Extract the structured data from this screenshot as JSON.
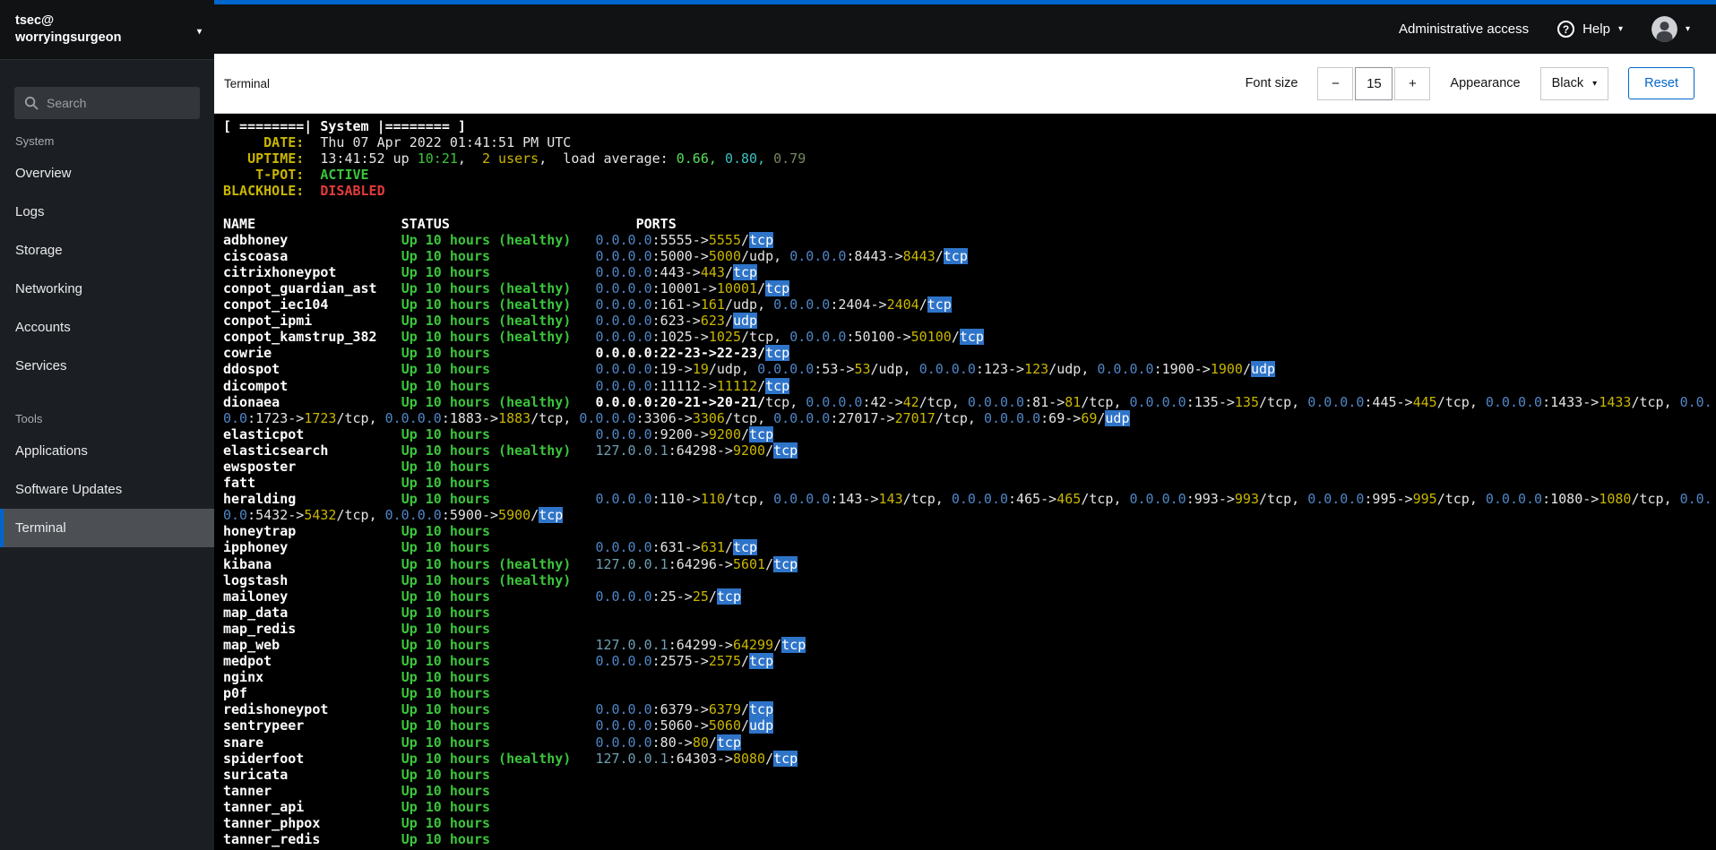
{
  "colors": {
    "accent": "#0066cc",
    "masthead_bg": "#101214",
    "sidebar_bg": "#1b1e22",
    "selected_bg": "#4c5054",
    "terminal_bg": "#000000",
    "term_fg": "#e4e4e4",
    "term_green": "#3bc43b",
    "term_green_bright": "#56e056",
    "term_yellow": "#c9b600",
    "term_red": "#e23b3b",
    "term_ip": "#4f86c6",
    "term_ip_local": "#6f9fb3",
    "term_teal": "#3fc0c0",
    "term_dim": "#75875f",
    "proto_hl": "#2e74c9"
  },
  "host": {
    "line1": "tsec@",
    "line2": "worryingsurgeon"
  },
  "masthead": {
    "admin_access_label": "Administrative access",
    "help_label": "Help"
  },
  "sidebar": {
    "search_placeholder": "Search",
    "active_item": "Terminal",
    "sections": [
      {
        "label": "System",
        "items": [
          "Overview",
          "Logs",
          "Storage",
          "Networking",
          "Accounts",
          "Services"
        ]
      },
      {
        "label": "Tools",
        "items": [
          "Applications",
          "Software Updates",
          "Terminal"
        ]
      }
    ]
  },
  "toolbar": {
    "title": "Terminal",
    "font_size_label": "Font size",
    "decrease_label": "−",
    "font_size_value": "15",
    "increase_label": "+",
    "appearance_label": "Appearance",
    "theme_value": "Black",
    "reset_label": "Reset"
  },
  "terminal": {
    "banner": "[ ========| System |======== ]",
    "info": [
      {
        "label": "DATE:",
        "segments": [
          {
            "text": "Thu 07 Apr 2022 01:41:51 PM UTC",
            "color": "fg"
          }
        ]
      },
      {
        "label": "UPTIME:",
        "segments": [
          {
            "text": "13:41:52 up ",
            "color": "fg"
          },
          {
            "text": "10:21",
            "color": "green"
          },
          {
            "text": ",  ",
            "color": "fg"
          },
          {
            "text": "2 users",
            "color": "yellow"
          },
          {
            "text": ",  load average: ",
            "color": "fg"
          },
          {
            "text": "0.66,",
            "color": "green_bright"
          },
          {
            "text": " ",
            "color": "fg"
          },
          {
            "text": "0.80,",
            "color": "teal"
          },
          {
            "text": " ",
            "color": "fg"
          },
          {
            "text": "0.79",
            "color": "dim"
          }
        ]
      },
      {
        "label": "T-POT:",
        "segments": [
          {
            "text": "ACTIVE",
            "color": "green",
            "bold": true
          }
        ]
      },
      {
        "label": "BLACKHOLE:",
        "segments": [
          {
            "text": "DISABLED",
            "color": "red",
            "bold": true
          }
        ]
      }
    ],
    "columns": [
      "NAME",
      "STATUS",
      "PORTS"
    ],
    "services": [
      {
        "name": "adbhoney",
        "status": "Up 10 hours (healthy)",
        "ports": [
          {
            "ip": "0.0.0.0",
            "from": "5555",
            "to": "5555",
            "proto": "tcp"
          }
        ]
      },
      {
        "name": "ciscoasa",
        "status": "Up 10 hours",
        "ports": [
          {
            "ip": "0.0.0.0",
            "from": "5000",
            "to": "5000",
            "proto": "udp"
          },
          {
            "ip": "0.0.0.0",
            "from": "8443",
            "to": "8443",
            "proto": "tcp"
          }
        ]
      },
      {
        "name": "citrixhoneypot",
        "status": "Up 10 hours",
        "ports": [
          {
            "ip": "0.0.0.0",
            "from": "443",
            "to": "443",
            "proto": "tcp"
          }
        ]
      },
      {
        "name": "conpot_guardian_ast",
        "status": "Up 10 hours (healthy)",
        "ports": [
          {
            "ip": "0.0.0.0",
            "from": "10001",
            "to": "10001",
            "proto": "tcp"
          }
        ]
      },
      {
        "name": "conpot_iec104",
        "status": "Up 10 hours (healthy)",
        "ports": [
          {
            "ip": "0.0.0.0",
            "from": "161",
            "to": "161",
            "proto": "udp"
          },
          {
            "ip": "0.0.0.0",
            "from": "2404",
            "to": "2404",
            "proto": "tcp"
          }
        ]
      },
      {
        "name": "conpot_ipmi",
        "status": "Up 10 hours (healthy)",
        "ports": [
          {
            "ip": "0.0.0.0",
            "from": "623",
            "to": "623",
            "proto": "udp"
          }
        ]
      },
      {
        "name": "conpot_kamstrup_382",
        "status": "Up 10 hours (healthy)",
        "ports": [
          {
            "ip": "0.0.0.0",
            "from": "1025",
            "to": "1025",
            "proto": "tcp"
          },
          {
            "ip": "0.0.0.0",
            "from": "50100",
            "to": "50100",
            "proto": "tcp"
          }
        ]
      },
      {
        "name": "cowrie",
        "status": "Up 10 hours",
        "ports": [
          {
            "ip": "0.0.0.0",
            "from": "22-23",
            "to": "22-23",
            "proto": "tcp",
            "emph": true
          }
        ]
      },
      {
        "name": "ddospot",
        "status": "Up 10 hours",
        "ports": [
          {
            "ip": "0.0.0.0",
            "from": "19",
            "to": "19",
            "proto": "udp"
          },
          {
            "ip": "0.0.0.0",
            "from": "53",
            "to": "53",
            "proto": "udp"
          },
          {
            "ip": "0.0.0.0",
            "from": "123",
            "to": "123",
            "proto": "udp"
          },
          {
            "ip": "0.0.0.0",
            "from": "1900",
            "to": "1900",
            "proto": "udp"
          }
        ]
      },
      {
        "name": "dicompot",
        "status": "Up 10 hours",
        "ports": [
          {
            "ip": "0.0.0.0",
            "from": "11112",
            "to": "11112",
            "proto": "tcp"
          }
        ]
      },
      {
        "name": "dionaea",
        "status": "Up 10 hours (healthy)",
        "ports": [
          {
            "ip": "0.0.0.0",
            "from": "20-21",
            "to": "20-21",
            "proto": "tcp",
            "emph": true
          },
          {
            "ip": "0.0.0.0",
            "from": "42",
            "to": "42",
            "proto": "tcp"
          },
          {
            "ip": "0.0.0.0",
            "from": "81",
            "to": "81",
            "proto": "tcp"
          },
          {
            "ip": "0.0.0.0",
            "from": "135",
            "to": "135",
            "proto": "tcp"
          },
          {
            "ip": "0.0.0.0",
            "from": "445",
            "to": "445",
            "proto": "tcp"
          },
          {
            "ip": "0.0.0.0",
            "from": "1433",
            "to": "1433",
            "proto": "tcp"
          },
          {
            "ip": "0.0.0.0",
            "from": "1723",
            "to": "1723",
            "proto": "tcp"
          },
          {
            "ip": "0.0.0.0",
            "from": "1883",
            "to": "1883",
            "proto": "tcp"
          },
          {
            "ip": "0.0.0.0",
            "from": "3306",
            "to": "3306",
            "proto": "tcp"
          },
          {
            "ip": "0.0.0.0",
            "from": "27017",
            "to": "27017",
            "proto": "tcp"
          },
          {
            "ip": "0.0.0.0",
            "from": "69",
            "to": "69",
            "proto": "udp"
          }
        ]
      },
      {
        "name": "elasticpot",
        "status": "Up 10 hours",
        "ports": [
          {
            "ip": "0.0.0.0",
            "from": "9200",
            "to": "9200",
            "proto": "tcp"
          }
        ]
      },
      {
        "name": "elasticsearch",
        "status": "Up 10 hours (healthy)",
        "ports": [
          {
            "ip": "127.0.0.1",
            "from": "64298",
            "to": "9200",
            "proto": "tcp"
          }
        ]
      },
      {
        "name": "ewsposter",
        "status": "Up 10 hours",
        "ports": []
      },
      {
        "name": "fatt",
        "status": "Up 10 hours",
        "ports": []
      },
      {
        "name": "heralding",
        "status": "Up 10 hours",
        "ports": [
          {
            "ip": "0.0.0.0",
            "from": "110",
            "to": "110",
            "proto": "tcp"
          },
          {
            "ip": "0.0.0.0",
            "from": "143",
            "to": "143",
            "proto": "tcp"
          },
          {
            "ip": "0.0.0.0",
            "from": "465",
            "to": "465",
            "proto": "tcp"
          },
          {
            "ip": "0.0.0.0",
            "from": "993",
            "to": "993",
            "proto": "tcp"
          },
          {
            "ip": "0.0.0.0",
            "from": "995",
            "to": "995",
            "proto": "tcp"
          },
          {
            "ip": "0.0.0.0",
            "from": "1080",
            "to": "1080",
            "proto": "tcp"
          },
          {
            "ip": "0.0.0.0",
            "from": "5432",
            "to": "5432",
            "proto": "tcp"
          },
          {
            "ip": "0.0.0.0",
            "from": "5900",
            "to": "5900",
            "proto": "tcp"
          }
        ]
      },
      {
        "name": "honeytrap",
        "status": "Up 10 hours",
        "ports": []
      },
      {
        "name": "ipphoney",
        "status": "Up 10 hours",
        "ports": [
          {
            "ip": "0.0.0.0",
            "from": "631",
            "to": "631",
            "proto": "tcp"
          }
        ]
      },
      {
        "name": "kibana",
        "status": "Up 10 hours (healthy)",
        "ports": [
          {
            "ip": "127.0.0.1",
            "from": "64296",
            "to": "5601",
            "proto": "tcp"
          }
        ]
      },
      {
        "name": "logstash",
        "status": "Up 10 hours (healthy)",
        "ports": []
      },
      {
        "name": "mailoney",
        "status": "Up 10 hours",
        "ports": [
          {
            "ip": "0.0.0.0",
            "from": "25",
            "to": "25",
            "proto": "tcp"
          }
        ]
      },
      {
        "name": "map_data",
        "status": "Up 10 hours",
        "ports": []
      },
      {
        "name": "map_redis",
        "status": "Up 10 hours",
        "ports": []
      },
      {
        "name": "map_web",
        "status": "Up 10 hours",
        "ports": [
          {
            "ip": "127.0.0.1",
            "from": "64299",
            "to": "64299",
            "proto": "tcp"
          }
        ]
      },
      {
        "name": "medpot",
        "status": "Up 10 hours",
        "ports": [
          {
            "ip": "0.0.0.0",
            "from": "2575",
            "to": "2575",
            "proto": "tcp"
          }
        ]
      },
      {
        "name": "nginx",
        "status": "Up 10 hours",
        "ports": []
      },
      {
        "name": "p0f",
        "status": "Up 10 hours",
        "ports": []
      },
      {
        "name": "redishoneypot",
        "status": "Up 10 hours",
        "ports": [
          {
            "ip": "0.0.0.0",
            "from": "6379",
            "to": "6379",
            "proto": "tcp"
          }
        ]
      },
      {
        "name": "sentrypeer",
        "status": "Up 10 hours",
        "ports": [
          {
            "ip": "0.0.0.0",
            "from": "5060",
            "to": "5060",
            "proto": "udp"
          }
        ]
      },
      {
        "name": "snare",
        "status": "Up 10 hours",
        "ports": [
          {
            "ip": "0.0.0.0",
            "from": "80",
            "to": "80",
            "proto": "tcp"
          }
        ]
      },
      {
        "name": "spiderfoot",
        "status": "Up 10 hours (healthy)",
        "ports": [
          {
            "ip": "127.0.0.1",
            "from": "64303",
            "to": "8080",
            "proto": "tcp"
          }
        ]
      },
      {
        "name": "suricata",
        "status": "Up 10 hours",
        "ports": []
      },
      {
        "name": "tanner",
        "status": "Up 10 hours",
        "ports": []
      },
      {
        "name": "tanner_api",
        "status": "Up 10 hours",
        "ports": []
      },
      {
        "name": "tanner_phpox",
        "status": "Up 10 hours",
        "ports": []
      },
      {
        "name": "tanner_redis",
        "status": "Up 10 hours",
        "ports": []
      }
    ]
  }
}
